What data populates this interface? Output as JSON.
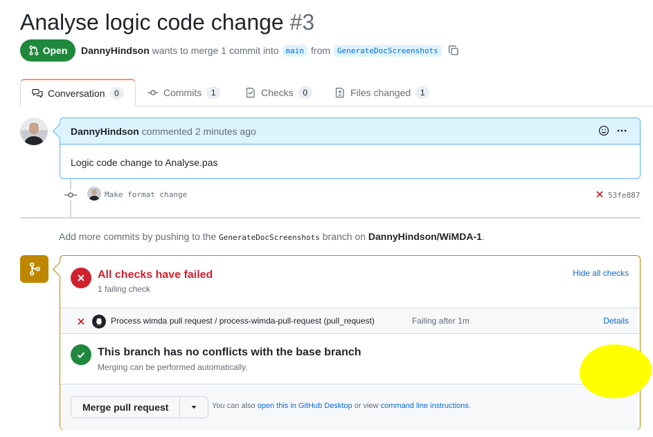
{
  "pr": {
    "title": "Analyse logic code change",
    "number": "#3",
    "state": "Open",
    "author": "DannyHindson",
    "meta_text": "wants to merge 1 commit into",
    "base_branch": "main",
    "from_text": "from",
    "head_branch": "GenerateDocScreenshots"
  },
  "tabs": [
    {
      "label": "Conversation",
      "count": "0",
      "icon": "comment-discussion-icon"
    },
    {
      "label": "Commits",
      "count": "1",
      "icon": "git-commit-icon"
    },
    {
      "label": "Checks",
      "count": "0",
      "icon": "checklist-icon"
    },
    {
      "label": "Files changed",
      "count": "1",
      "icon": "file-diff-icon"
    }
  ],
  "comment": {
    "author": "DannyHindson",
    "action": "commented 2 minutes ago",
    "body": "Logic code change to Analyse.pas"
  },
  "commit": {
    "message": "Make format change",
    "sha": "53fe887"
  },
  "push_hint": {
    "prefix": "Add more commits by pushing to the",
    "branch": "GenerateDocScreenshots",
    "middle": "branch on",
    "repo": "DannyHindson/WiMDA-1",
    "suffix": "."
  },
  "checks": {
    "title": "All checks have failed",
    "subtitle": "1 failing check",
    "hide_link": "Hide all checks",
    "row_name": "Process wimda pull request / process-wimda-pull-request (pull_request)",
    "row_status": "Failing after 1m",
    "details_link": "Details"
  },
  "conflicts": {
    "title": "This branch has no conflicts with the base branch",
    "subtitle": "Merging can be performed automatically."
  },
  "merge": {
    "button": "Merge pull request",
    "footer_prefix": "You can also",
    "desktop_link": "open this in GitHub Desktop",
    "footer_middle": "or view",
    "cli_link": "command line instructions",
    "footer_suffix": "."
  },
  "colors": {
    "open_green": "#1f883d",
    "fail_red": "#cf222e",
    "warning_amber": "#bf8700",
    "link_blue": "#0969da",
    "highlight_yellow": "#ffff00"
  }
}
